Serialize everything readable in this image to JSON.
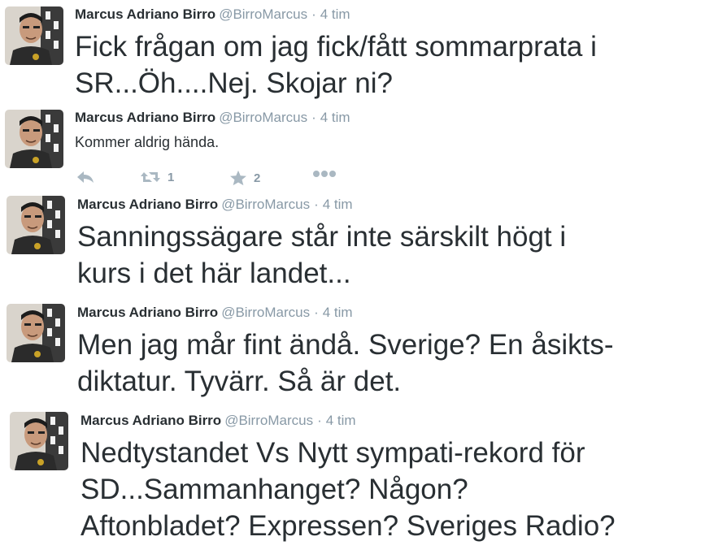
{
  "tweets": [
    {
      "name": "Marcus Adriano Birro",
      "handle": "@BirroMarcus",
      "separator": "·",
      "time": "4 tim",
      "lines": [
        "Fick frågan om jag fick/fått sommarprata i",
        "SR...Öh....Nej. Skojar ni?"
      ]
    },
    {
      "name": "Marcus Adriano Birro",
      "handle": "@BirroMarcus",
      "separator": "·",
      "time": "4 tim",
      "lines": [
        "Kommer aldrig hända."
      ],
      "actions": {
        "retweet_count": "1",
        "favorite_count": "2"
      }
    },
    {
      "name": "Marcus Adriano Birro",
      "handle": "@BirroMarcus",
      "separator": "·",
      "time": "4 tim",
      "lines": [
        "Sanningssägare står inte särskilt högt i",
        "kurs i det här landet..."
      ]
    },
    {
      "name": "Marcus Adriano Birro",
      "handle": "@BirroMarcus",
      "separator": "·",
      "time": "4 tim",
      "lines": [
        "Men jag mår fint ändå. Sverige? En åsikts-",
        "diktatur. Tyvärr. Så är det."
      ]
    },
    {
      "name": "Marcus Adriano Birro",
      "handle": "@BirroMarcus",
      "separator": "·",
      "time": "4 tim",
      "lines": [
        "Nedtystandet Vs Nytt sympati-rekord för",
        "SD...Sammanhanget? Någon?",
        "Aftonbladet? Expressen? Sveriges Radio?"
      ]
    }
  ],
  "icons": {
    "reply": "reply-icon",
    "retweet": "retweet-icon",
    "favorite": "star-icon",
    "more": "more-icon"
  },
  "colors": {
    "text": "#292f33",
    "meta": "#8899a6",
    "action": "#aab8c2"
  }
}
